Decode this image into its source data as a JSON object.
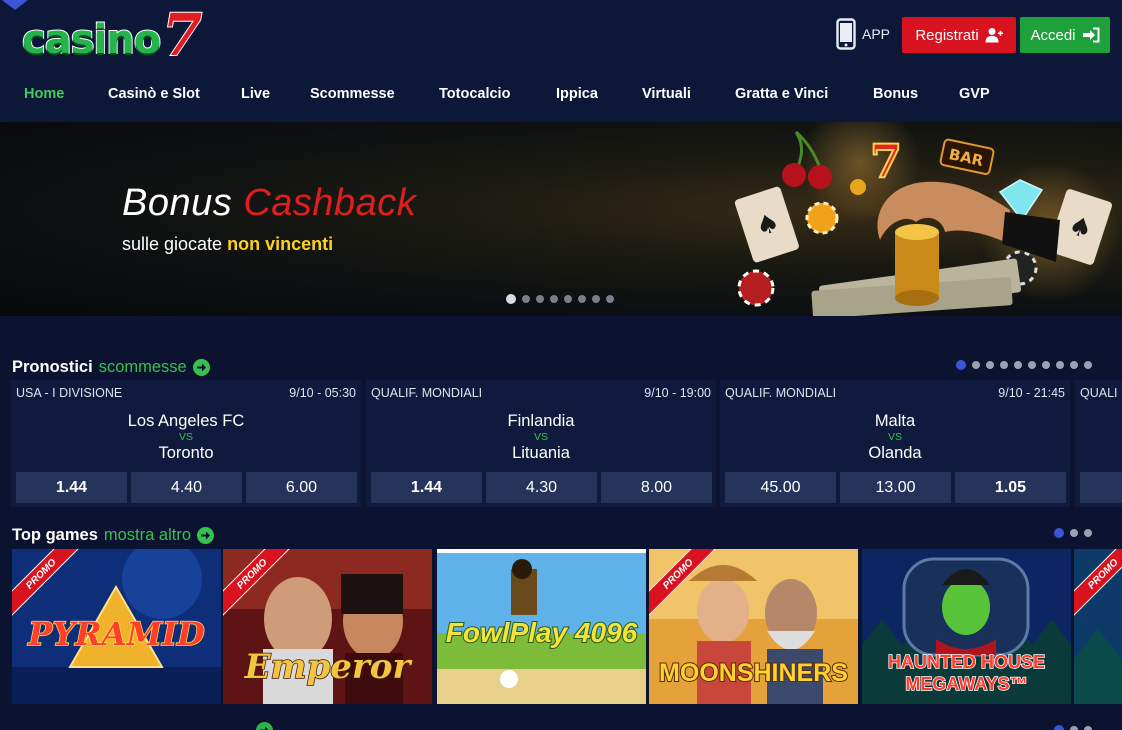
{
  "header": {
    "logo_text": "casino",
    "logo_number": "7",
    "app_label": "APP",
    "register_label": "Registrati",
    "login_label": "Accedi"
  },
  "nav": {
    "items": [
      {
        "label": "Home",
        "active": true
      },
      {
        "label": "Casinò e Slot"
      },
      {
        "label": "Live"
      },
      {
        "label": "Scommesse"
      },
      {
        "label": "Totocalcio"
      },
      {
        "label": "Ippica"
      },
      {
        "label": "Virtuali"
      },
      {
        "label": "Gratta e Vinci"
      },
      {
        "label": "Bonus"
      },
      {
        "label": "GVP"
      }
    ]
  },
  "hero": {
    "title_white": "Bonus",
    "title_red": "Cashback",
    "subtitle_plain": "sulle giocate",
    "subtitle_highlight": "non vincenti",
    "slide_count": 8,
    "active_slide": 1
  },
  "predictions": {
    "title": "Pronostici",
    "title_accent": "scommesse",
    "page_count": 10,
    "active_page": 1,
    "matches": [
      {
        "league": "USA - I DIVISIONE",
        "datetime": "9/10 - 05:30",
        "home": "Los Angeles FC",
        "vs": "VS",
        "away": "Toronto",
        "odds": [
          {
            "value": "1.44",
            "best": true
          },
          {
            "value": "4.40"
          },
          {
            "value": "6.00"
          }
        ]
      },
      {
        "league": "QUALIF. MONDIALI",
        "datetime": "9/10 - 19:00",
        "home": "Finlandia",
        "vs": "VS",
        "away": "Lituania",
        "odds": [
          {
            "value": "1.44",
            "best": true
          },
          {
            "value": "4.30"
          },
          {
            "value": "8.00"
          }
        ]
      },
      {
        "league": "QUALIF. MONDIALI",
        "datetime": "9/10 - 21:45",
        "home": "Malta",
        "vs": "VS",
        "away": "Olanda",
        "odds": [
          {
            "value": "45.00"
          },
          {
            "value": "13.00"
          },
          {
            "value": "1.05",
            "best": true
          }
        ]
      },
      {
        "league": "QUALI"
      }
    ]
  },
  "top_games": {
    "title": "Top games",
    "more_label": "mostra altro",
    "page_count": 3,
    "active_page": 1,
    "promo_label": "PROMO",
    "games": [
      {
        "name": "PYRAMID",
        "promo": true
      },
      {
        "name": "Emperor",
        "promo": true
      },
      {
        "name": "FowlPlay 4096",
        "promo": false
      },
      {
        "name": "MOONSHINERS",
        "promo": true
      },
      {
        "name": "HAUNTED HOUSE MEGAWAYS™",
        "promo": false
      },
      {
        "name": "",
        "promo": true
      }
    ]
  },
  "colors": {
    "brand_green": "#35c24c",
    "brand_red": "#d8121f",
    "nav_active": "#40d05a",
    "background": "#0b1330",
    "card": "#0f1a3d",
    "odd_button": "#26335a"
  }
}
